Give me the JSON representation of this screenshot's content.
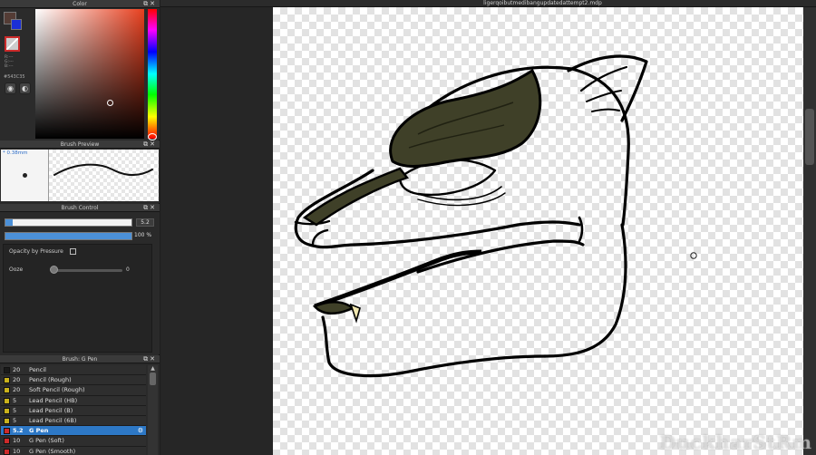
{
  "color_panel": {
    "title": "Color",
    "rgb_lines": [
      "R:---",
      "G:---",
      "B:---"
    ],
    "hex": "#543C35",
    "foreground_color": "#543C35",
    "background_color": "#1B2FD6",
    "icons": [
      "color-picker-icon",
      "color-mix-icon"
    ]
  },
  "document": {
    "title": "ligerqoibutmedibangupdatedattempt2.mdp"
  },
  "brush_preview": {
    "title": "Brush Preview",
    "size": "0.38mm"
  },
  "brush_control": {
    "title": "Brush Control",
    "size_value": "5.2",
    "size_fraction": 0.06,
    "opacity_value": "100 %",
    "opacity_fraction": 1.0,
    "opacity_by_pressure_label": "Opacity by Pressure",
    "opacity_by_pressure_checked": false,
    "ooze_label": "Ooze",
    "ooze_value": "0"
  },
  "brush_list": {
    "title": "Brush: G Pen",
    "items": [
      {
        "size": "20",
        "name": "Pencil",
        "color": "#1a1a1a",
        "selected": false
      },
      {
        "size": "20",
        "name": "Pencil (Rough)",
        "color": "#c9b21c",
        "selected": false
      },
      {
        "size": "20",
        "name": "Soft Pencil (Rough)",
        "color": "#c9b21c",
        "selected": false
      },
      {
        "size": "5",
        "name": "Lead Pencil (HB)",
        "color": "#c9b21c",
        "selected": false
      },
      {
        "size": "5",
        "name": "Lead Pencil (B)",
        "color": "#c9b21c",
        "selected": false
      },
      {
        "size": "5",
        "name": "Lead Pencil (6B)",
        "color": "#c9b21c",
        "selected": false
      },
      {
        "size": "5.2",
        "name": "G Pen",
        "color": "#cc2a2a",
        "selected": true
      },
      {
        "size": "10",
        "name": "G Pen (Soft)",
        "color": "#cc2a2a",
        "selected": false
      },
      {
        "size": "10",
        "name": "G Pen (Smooth)",
        "color": "#cc2a2a",
        "selected": false
      }
    ]
  },
  "watermark": "DuckharStRm",
  "colors": {
    "accent": "#2D78C6",
    "line_art": "#000000",
    "fill_olive": "#3F4028",
    "tooth": "#F2E8B0"
  }
}
